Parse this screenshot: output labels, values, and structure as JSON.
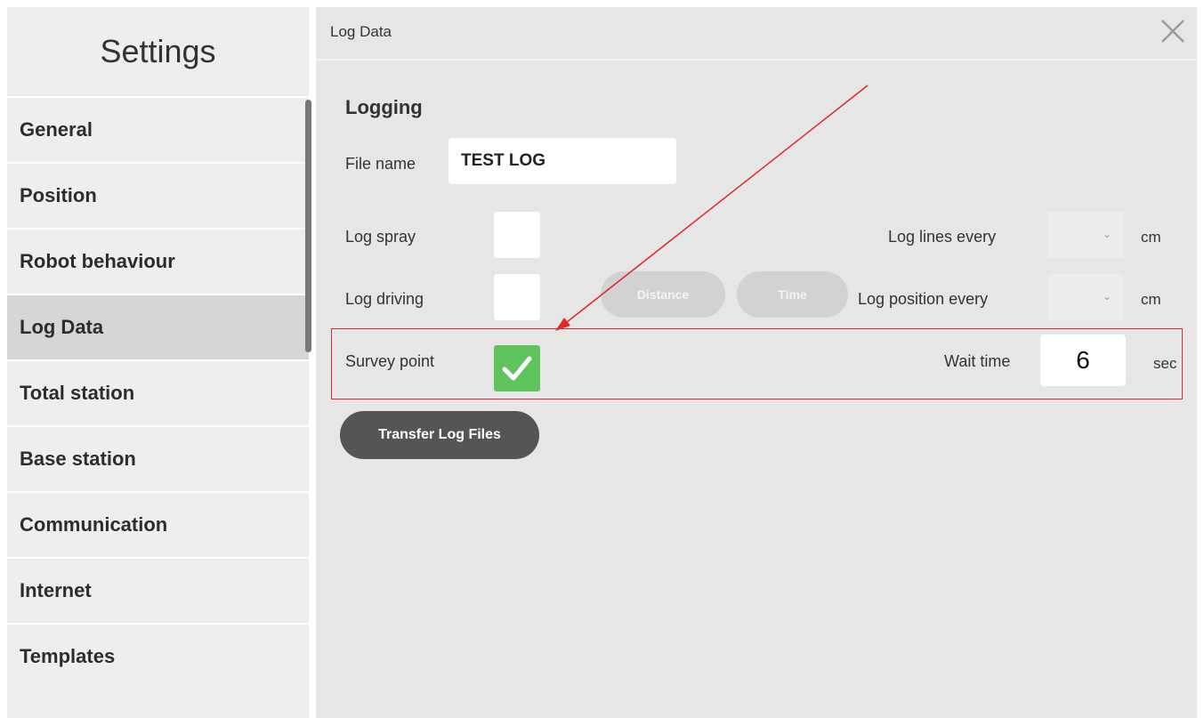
{
  "sidebar": {
    "title": "Settings",
    "items": [
      {
        "label": "General"
      },
      {
        "label": "Position"
      },
      {
        "label": "Robot behaviour"
      },
      {
        "label": "Log Data",
        "active": true
      },
      {
        "label": "Total station"
      },
      {
        "label": "Base station"
      },
      {
        "label": "Communication"
      },
      {
        "label": "Internet"
      },
      {
        "label": "Templates"
      }
    ]
  },
  "header": {
    "title": "Log Data",
    "close_icon": "close-icon"
  },
  "logging": {
    "section_title": "Logging",
    "file_name_label": "File name",
    "file_name_value": "TEST LOG",
    "log_spray_label": "Log spray",
    "log_spray_checked": false,
    "log_driving_label": "Log driving",
    "log_driving_checked": false,
    "distance_label": "Distance",
    "time_label": "Time",
    "log_lines_label": "Log lines every",
    "log_lines_value": "",
    "log_lines_unit": "cm",
    "log_position_label": "Log position every",
    "log_position_value": "",
    "log_position_unit": "cm",
    "survey_point_label": "Survey point",
    "survey_point_checked": true,
    "wait_time_label": "Wait time",
    "wait_time_value": "6",
    "wait_time_unit": "sec",
    "transfer_button_label": "Transfer Log Files"
  },
  "colors": {
    "accent_check": "#5fc45e",
    "annotation": "#e0282a",
    "button_dark": "#555555"
  }
}
